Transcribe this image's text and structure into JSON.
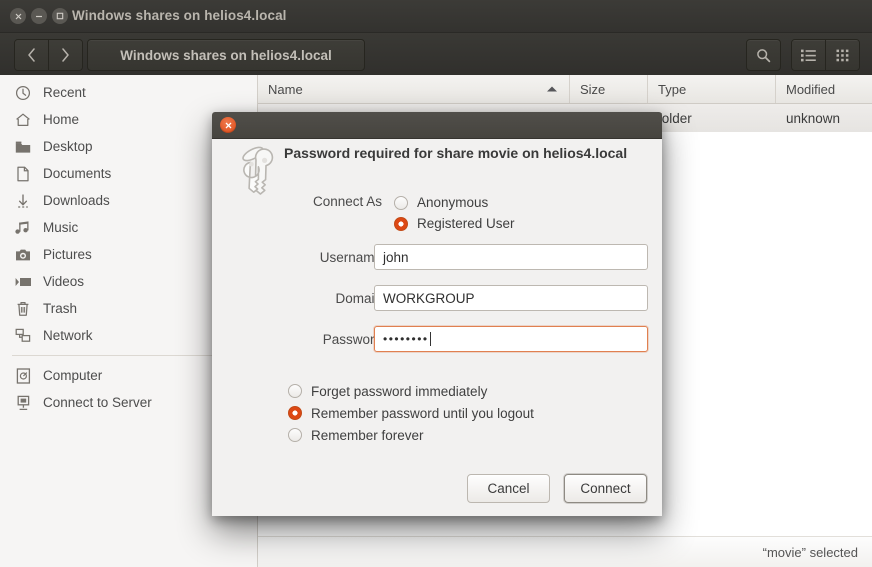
{
  "window": {
    "title": "Windows shares on helios4.local",
    "controls": [
      {
        "name": "close",
        "glyph": "×"
      },
      {
        "name": "minimize",
        "glyph": "−"
      },
      {
        "name": "maximize",
        "glyph": "□"
      }
    ]
  },
  "toolbar": {
    "back_tooltip": "Back",
    "forward_tooltip": "Forward",
    "path_label": "Windows shares on helios4.local",
    "search_label": "Search",
    "list_view_label": "List view",
    "grid_view_label": "Icon view"
  },
  "sidebar": {
    "items": [
      {
        "label": "Recent",
        "icon": "clock-icon"
      },
      {
        "label": "Home",
        "icon": "home-icon"
      },
      {
        "label": "Desktop",
        "icon": "folder-icon"
      },
      {
        "label": "Documents",
        "icon": "document-icon"
      },
      {
        "label": "Downloads",
        "icon": "download-icon"
      },
      {
        "label": "Music",
        "icon": "music-icon"
      },
      {
        "label": "Pictures",
        "icon": "camera-icon"
      },
      {
        "label": "Videos",
        "icon": "video-icon"
      },
      {
        "label": "Trash",
        "icon": "trash-icon"
      },
      {
        "label": "Network",
        "icon": "network-icon"
      }
    ],
    "devices": [
      {
        "label": "Computer",
        "icon": "computer-icon"
      },
      {
        "label": "Connect to Server",
        "icon": "server-icon"
      }
    ]
  },
  "filelist": {
    "columns": [
      "Name",
      "Size",
      "Type",
      "Modified"
    ],
    "sort_column": "Name",
    "sort_direction": "ascending",
    "rows": [
      {
        "name": "",
        "size": "",
        "type": "folder",
        "modified": "unknown"
      }
    ]
  },
  "statusbar": {
    "text": "“movie” selected"
  },
  "dialog": {
    "close_label": "Close",
    "icon": "keyring-icon",
    "heading": "Password required for share movie on helios4.local",
    "connect_as_label": "Connect As",
    "connect_as_options": [
      {
        "label": "Anonymous",
        "selected": false
      },
      {
        "label": "Registered User",
        "selected": true
      }
    ],
    "fields": [
      {
        "label": "Username",
        "value": "john",
        "focused": false
      },
      {
        "label": "Domain",
        "value": "WORKGROUP",
        "focused": false
      },
      {
        "label": "Password",
        "value": "••••••••",
        "focused": true
      }
    ],
    "remember_options": [
      {
        "label": "Forget password immediately",
        "selected": false
      },
      {
        "label": "Remember password until you logout",
        "selected": true
      },
      {
        "label": "Remember forever",
        "selected": false
      }
    ],
    "buttons": [
      {
        "label": "Cancel",
        "default": false
      },
      {
        "label": "Connect",
        "default": true
      }
    ]
  },
  "colors": {
    "accent": "#dd4814",
    "titlebar": "#3c3b37",
    "dialog_titlebar": "#4a4845",
    "panel_bg": "#f2f1f0"
  }
}
